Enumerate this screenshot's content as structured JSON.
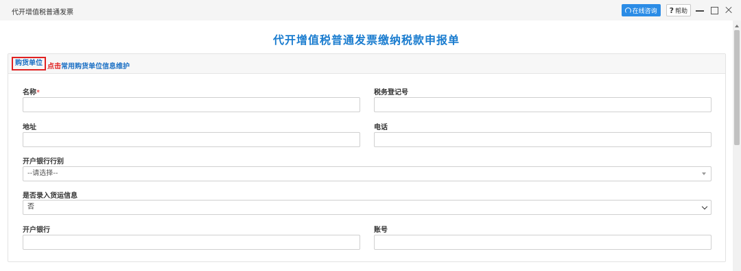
{
  "window": {
    "title": "代开增值税普通发票",
    "consult_label": "在线咨询",
    "help_q": "?",
    "help_label": "帮助"
  },
  "page": {
    "title": "代开增值税普通发票缴纳税款申报单"
  },
  "panel": {
    "tab_label": "购货单位",
    "link_click": "点击",
    "link_text": "常用购货单位信息维护"
  },
  "form": {
    "name_label": "名称",
    "required_mark": "*",
    "name_value": "",
    "tax_id_label": "税务登记号",
    "tax_id_value": "",
    "address_label": "地址",
    "address_value": "",
    "phone_label": "电话",
    "phone_value": "",
    "bank_type_label": "开户银行行别",
    "bank_type_value": "--请选择--",
    "freight_label": "是否录入货运信息",
    "freight_value": "否",
    "bank_label": "开户银行",
    "bank_value": "",
    "account_label": "账号",
    "account_value": ""
  },
  "colors": {
    "accent_blue": "#1a7ccf",
    "consult_bg": "#2b8ce6",
    "highlight_red": "#e02020"
  }
}
